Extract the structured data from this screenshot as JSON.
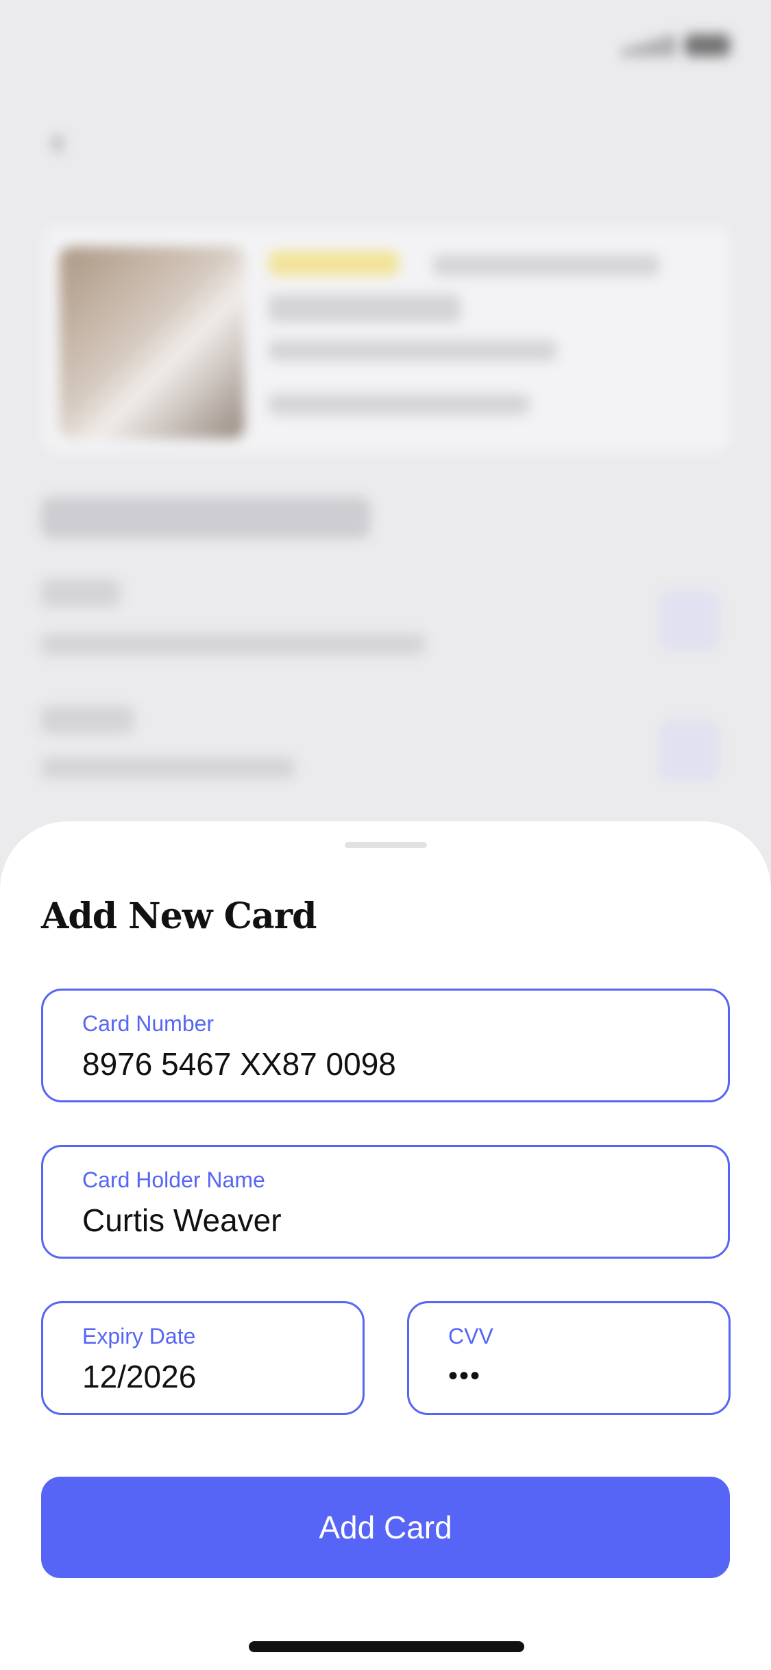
{
  "sheet": {
    "title": "Add New Card",
    "fields": {
      "card_number": {
        "label": "Card Number",
        "value": "8976 5467 XX87 0098"
      },
      "card_holder": {
        "label": "Card Holder Name",
        "value": "Curtis Weaver"
      },
      "expiry": {
        "label": "Expiry Date",
        "value": "12/2026"
      },
      "cvv": {
        "label": "CVV",
        "value": "•••"
      }
    },
    "submit_label": "Add Card"
  },
  "colors": {
    "accent": "#5665f5",
    "sheet_background": "#ffffff",
    "page_background": "#ebebed",
    "text_primary": "#111111"
  },
  "icons": {
    "back": "chevron-left-icon",
    "signal": "signal-icon",
    "battery": "battery-icon"
  }
}
